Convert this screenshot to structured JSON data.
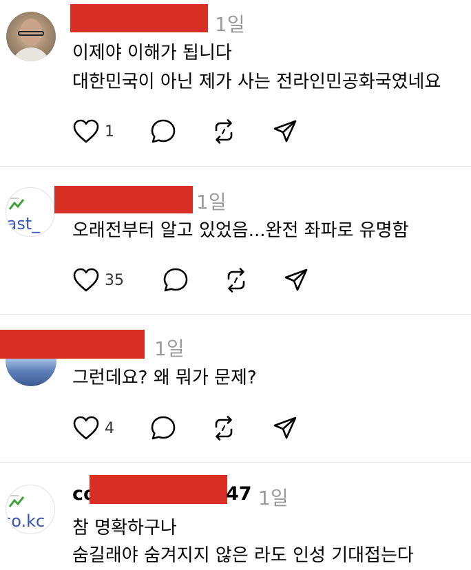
{
  "posts": [
    {
      "username_visible": "",
      "time": "1일",
      "lines": [
        "이제야 이해가 됩니다",
        "대한민국이 아닌 제가 사는 전라인민공화국였네요"
      ],
      "likes": "1",
      "avatar_type": "photo"
    },
    {
      "username_visible": "",
      "time": "1일",
      "lines": [
        "오래전부터 알고 있었음...완전 좌파로 유명함"
      ],
      "likes": "35",
      "avatar_type": "broken",
      "avatar_alt": "last_"
    },
    {
      "username_visible": "",
      "time": "1일",
      "lines": [
        "그런데요? 왜 뭐가 문제?"
      ],
      "likes": "4",
      "avatar_type": "sky"
    },
    {
      "username_prefix": "co",
      "username_suffix": "47",
      "time": "1일",
      "lines": [
        "참 명확하구나",
        "숨길래야 숨겨지지 않은 라도 인성 기대접는다"
      ],
      "avatar_type": "broken",
      "avatar_alt": "co.kc"
    }
  ],
  "icons": {
    "like": "heart-icon",
    "reply": "reply-bubble-icon",
    "repost": "repost-icon",
    "share": "send-icon"
  },
  "colors": {
    "redaction": "#d93025",
    "timestamp": "#9a9a9a",
    "separator": "#e4e4e4"
  }
}
